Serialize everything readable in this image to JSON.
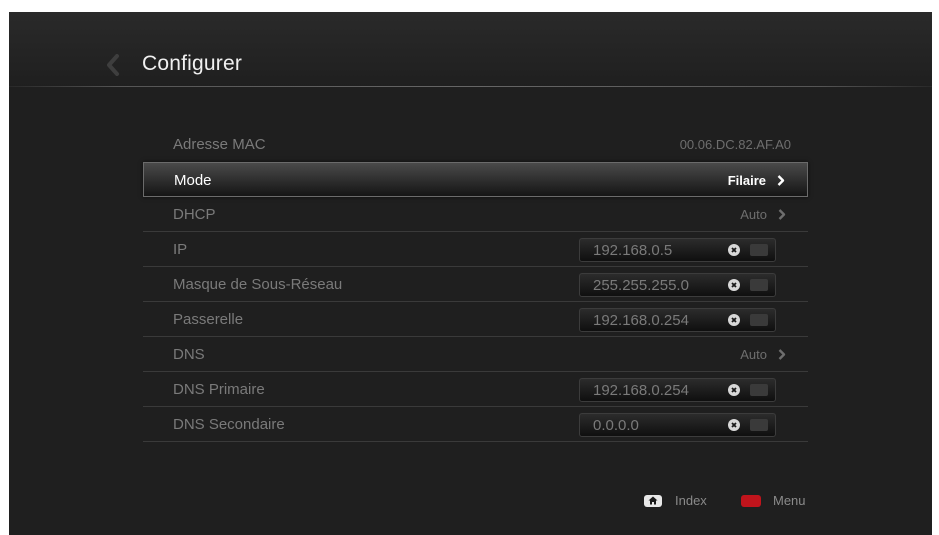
{
  "header": {
    "title": "Configurer",
    "back_icon": "chevron-left-icon"
  },
  "settings": {
    "mac": {
      "label": "Adresse MAC",
      "value": "00.06.DC.82.AF.A0"
    },
    "mode": {
      "label": "Mode",
      "value": "Filaire"
    },
    "dhcp": {
      "label": "DHCP",
      "value": "Auto"
    },
    "ip": {
      "label": "IP",
      "value": "192.168.0.5"
    },
    "subnet": {
      "label": "Masque de Sous-Réseau",
      "value": "255.255.255.0"
    },
    "gateway": {
      "label": "Passerelle",
      "value": "192.168.0.254"
    },
    "dns": {
      "label": "DNS",
      "value": "Auto"
    },
    "dns_primary": {
      "label": "DNS Primaire",
      "value": "192.168.0.254"
    },
    "dns_secondary": {
      "label": "DNS Secondaire",
      "value": "0.0.0.0"
    }
  },
  "footer": {
    "index_label": "Index",
    "menu_label": "Menu",
    "index_icon": "home-icon",
    "menu_icon": "red-key-icon",
    "menu_key_color": "#c0141c"
  },
  "colors": {
    "background": "#1f1f1f",
    "selected_border": "#6b6b6b"
  }
}
